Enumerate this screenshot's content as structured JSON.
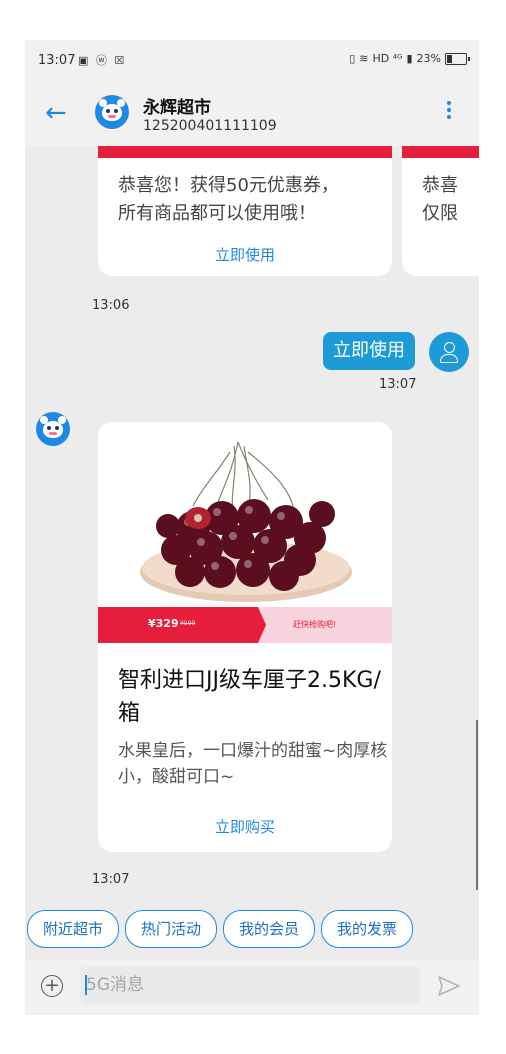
{
  "status_bar": {
    "time": "13:07",
    "indicators": "▣ ⓦ ☒",
    "network": "HD ⁴ᴳ",
    "battery": "23%"
  },
  "header": {
    "name": "永辉超市",
    "number": "125200401111109"
  },
  "coupons": [
    {
      "text_line1": "恭喜您！获得50元优惠券，",
      "text_line2": "所有商品都可以使用哦！",
      "action": "立即使用"
    },
    {
      "text_line1": "恭喜",
      "text_line2": "仅限",
      "action": ""
    }
  ],
  "messages": {
    "ts1": "13:06",
    "outgoing_text": "立即使用",
    "ts2": "13:07",
    "ts3": "13:07"
  },
  "product": {
    "price_now": "¥329",
    "price_old": "¥599",
    "price_cta": "赶快抢购吧!",
    "title": "智利进口JJ级车厘子2.5KG/箱",
    "desc": "水果皇后，一口爆汁的甜蜜~肉厚核小，酸甜可口~",
    "action": "立即购买"
  },
  "quick_replies": [
    "附近超市",
    "热门活动",
    "我的会员",
    "我的发票"
  ],
  "input": {
    "placeholder": "5G消息"
  },
  "colors": {
    "accent": "#1e88e5",
    "coupon_red": "#e61e3c",
    "bubble": "#1e9ad6"
  }
}
